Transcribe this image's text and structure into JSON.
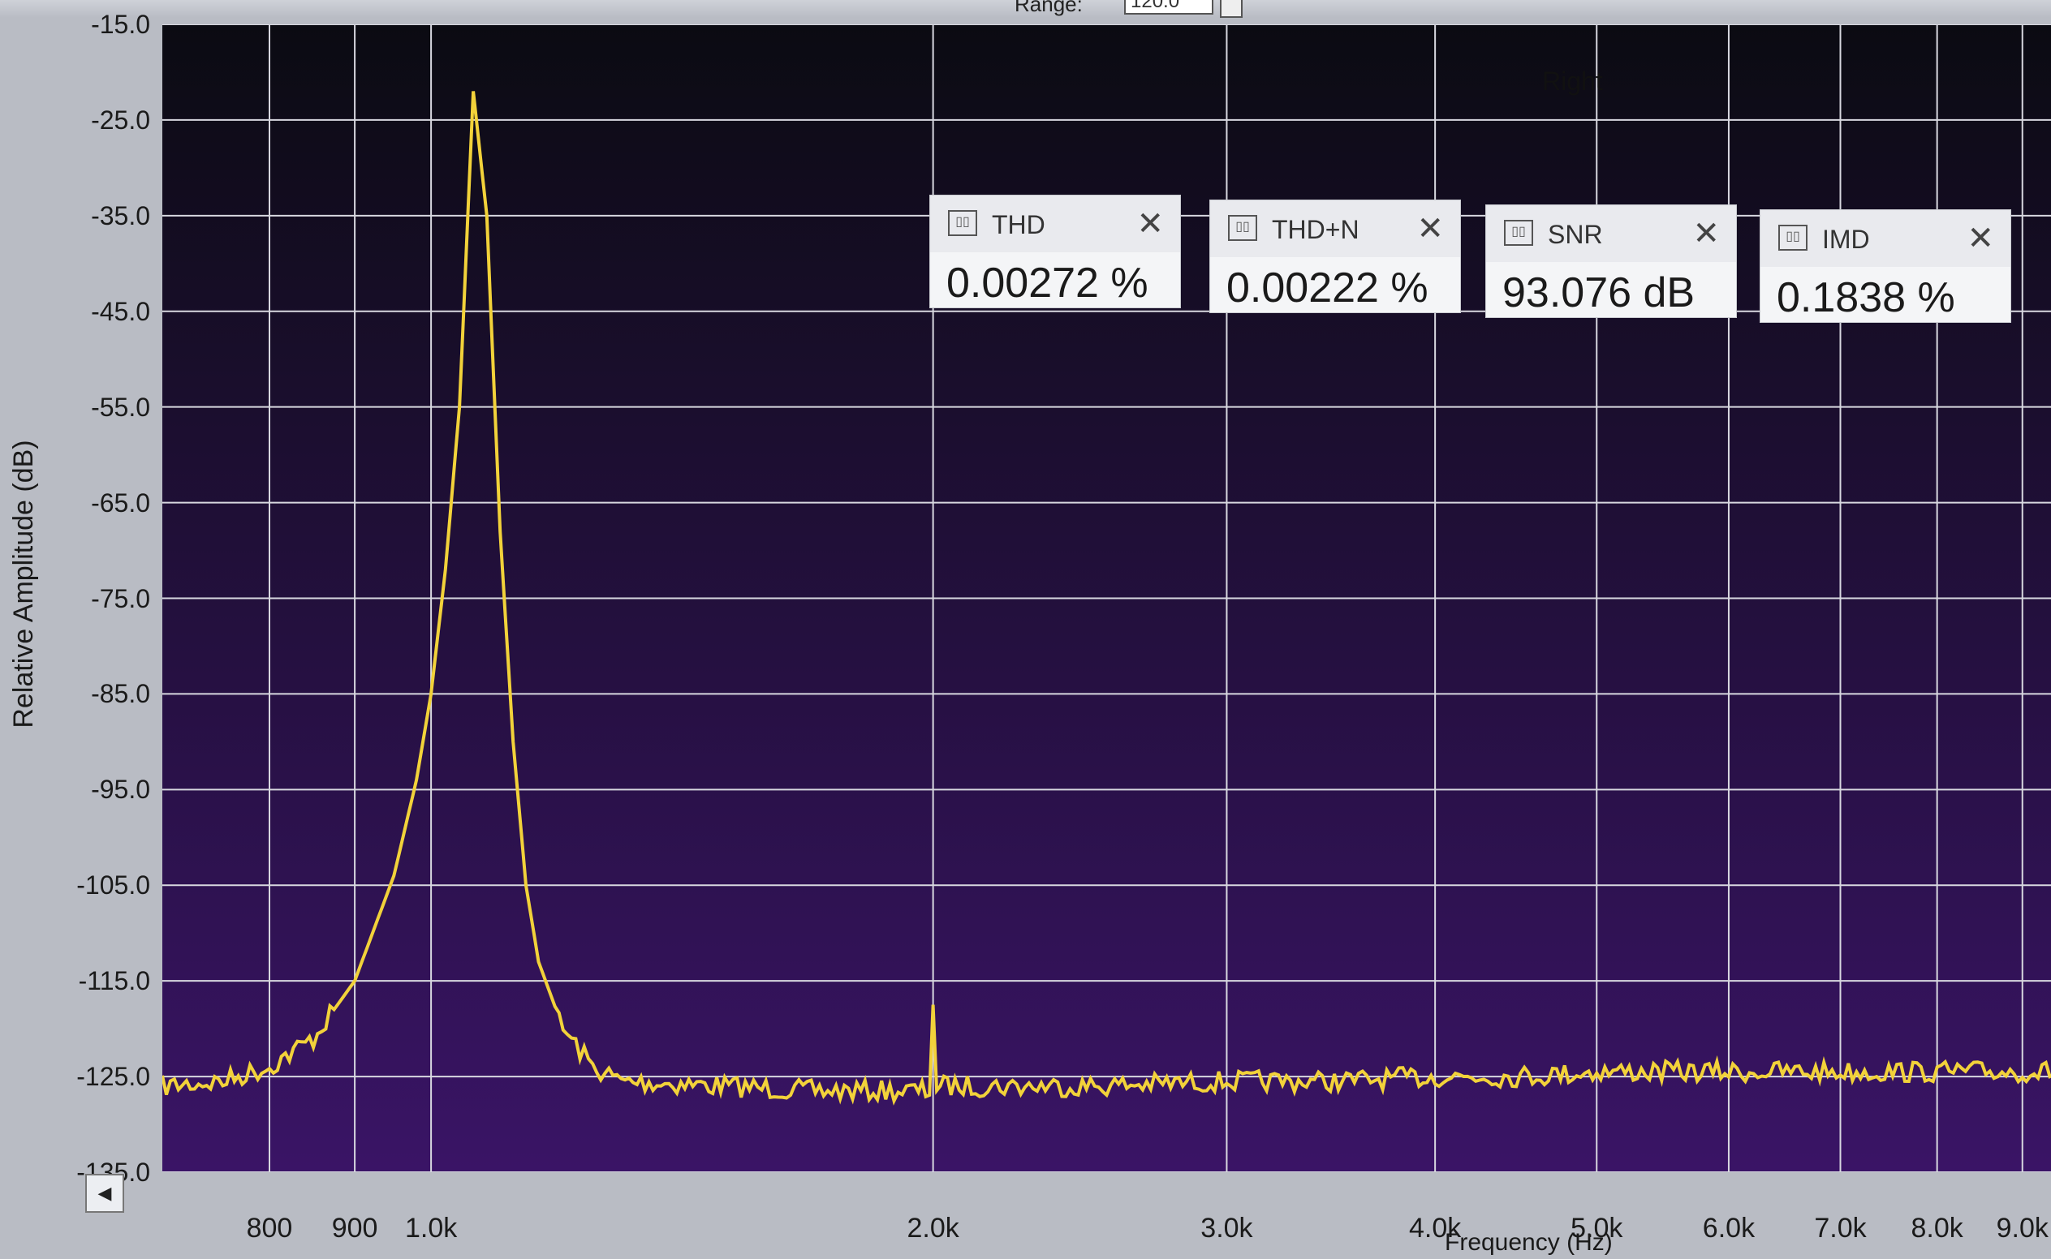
{
  "window": {
    "range_label": "Range:",
    "range_value": "120.0"
  },
  "measurements": [
    {
      "name": "THD",
      "value": "0.00272 %"
    },
    {
      "name": "THD+N",
      "value": "0.00222 %"
    },
    {
      "name": "SNR",
      "value": "93.076 dB"
    },
    {
      "name": "IMD",
      "value": "0.1838 %"
    }
  ],
  "icons": {
    "measurement": "pin-icon",
    "close": "close-icon",
    "scroll": "scroll-left-icon"
  },
  "colors": {
    "plot_background_top": "#0b0b12",
    "plot_background_bottom": "#3a1466",
    "grid": "#d8d8e0",
    "trace": "#f2d23a"
  },
  "chart_data": {
    "type": "line",
    "title": "Right",
    "xlabel": "Frequency (Hz)",
    "ylabel": "Relative Amplitude (dB)",
    "xscale": "log",
    "xlim": [
      690,
      9500
    ],
    "ylim": [
      -135,
      -15
    ],
    "grid": true,
    "yticks": [
      -15,
      -25,
      -35,
      -45,
      -55,
      -65,
      -75,
      -85,
      -95,
      -105,
      -115,
      -125,
      -135
    ],
    "ytick_labels": [
      "-15.0",
      "-25.0",
      "-35.0",
      "-45.0",
      "-55.0",
      "-65.0",
      "-75.0",
      "-85.0",
      "-95.0",
      "-105.0",
      "-115.0",
      "-125.0",
      "-135.0"
    ],
    "xticks": [
      800,
      900,
      1000,
      2000,
      3000,
      4000,
      5000,
      6000,
      7000,
      8000,
      9000
    ],
    "xtick_labels": [
      "800",
      "900",
      "1.0k",
      "2.0k",
      "3.0k",
      "4.0k",
      "5.0k",
      "6.0k",
      "7.0k",
      "8.0k",
      "9.0k"
    ],
    "series": [
      {
        "x": [
          690,
          750,
          800,
          850,
          900,
          950,
          980,
          1000,
          1020,
          1040,
          1060,
          1080,
          1100,
          1120,
          1140,
          1160,
          1200,
          1250,
          1300,
          1500,
          1700,
          1950,
          1990,
          2000,
          2010,
          2050,
          2500,
          3000,
          3500,
          4000,
          4500,
          5000,
          5500,
          6000,
          6500,
          7000,
          8000,
          9000,
          9500
        ],
        "y": [
          -126,
          -125.5,
          -124,
          -121,
          -115,
          -104,
          -94,
          -85,
          -72,
          -55,
          -22,
          -35,
          -68,
          -90,
          -105,
          -113,
          -120,
          -124,
          -125.5,
          -126,
          -126.5,
          -126.5,
          -126.5,
          -117.5,
          -126,
          -126,
          -126,
          -125.5,
          -125.5,
          -125,
          -125,
          -124.5,
          -124.5,
          -124.5,
          -124.5,
          -124.5,
          -124.5,
          -124.5,
          -124.5
        ]
      }
    ]
  }
}
